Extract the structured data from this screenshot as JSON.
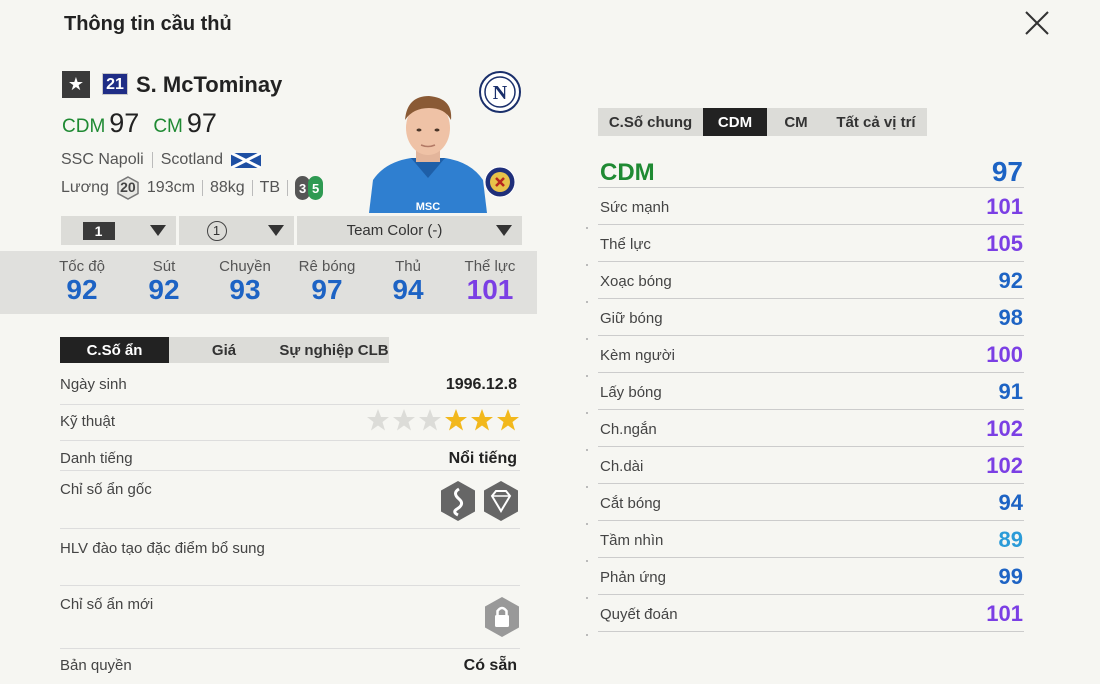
{
  "window": {
    "title": "Thông tin cầu thủ"
  },
  "player": {
    "season_num": "21",
    "name": "S. McTominay",
    "pos1_label": "CDM",
    "pos1_value": "97",
    "pos2_label": "CM",
    "pos2_value": "97",
    "club": "SSC Napoli",
    "nation": "Scotland",
    "salary_label": "Lương",
    "salary": "20",
    "height": "193cm",
    "weight": "88kg",
    "body_type": "TB",
    "weak_foot_left": "3",
    "weak_foot_right": "5"
  },
  "selectors": {
    "level": "1",
    "enhance": "1",
    "team_color": "Team Color (-)"
  },
  "main_stats": [
    {
      "label": "Tốc độ",
      "value": "92",
      "color": "#1d63c4"
    },
    {
      "label": "Sút",
      "value": "92",
      "color": "#1d63c4"
    },
    {
      "label": "Chuyền",
      "value": "93",
      "color": "#1d63c4"
    },
    {
      "label": "Rê bóng",
      "value": "97",
      "color": "#1d63c4"
    },
    {
      "label": "Thủ",
      "value": "94",
      "color": "#1d63c4"
    },
    {
      "label": "Thể lực",
      "value": "101",
      "color": "#7b3fe4"
    }
  ],
  "info_tabs": [
    "C.Số ẩn",
    "Giá",
    "Sự nghiệp CLB"
  ],
  "info": {
    "birth_label": "Ngày sinh",
    "birth": "1996.12.8",
    "skill_label": "Kỹ thuật",
    "skill_stars": 3,
    "skill_max": 6,
    "rep_label": "Danh tiếng",
    "rep": "Nổi tiếng",
    "traits_label": "Chỉ số ẩn gốc",
    "coach_label": "HLV đào tạo đặc điểm bổ sung",
    "new_traits_label": "Chỉ số ẩn mới",
    "license_label": "Bản quyền",
    "license": "Có sẵn"
  },
  "pos_tabs": [
    "C.Số chung",
    "CDM",
    "CM",
    "Tất cả vị trí"
  ],
  "pos_detail": {
    "label": "CDM",
    "value": "97",
    "rows": [
      {
        "label": "Sức mạnh",
        "value": "101",
        "color": "#7b3fe4"
      },
      {
        "label": "Thể lực",
        "value": "105",
        "color": "#7b3fe4"
      },
      {
        "label": "Xoạc bóng",
        "value": "92",
        "color": "#1d63c4"
      },
      {
        "label": "Giữ bóng",
        "value": "98",
        "color": "#1d63c4"
      },
      {
        "label": "Kèm người",
        "value": "100",
        "color": "#7b3fe4"
      },
      {
        "label": "Lấy bóng",
        "value": "91",
        "color": "#1d63c4"
      },
      {
        "label": "Ch.ngắn",
        "value": "102",
        "color": "#7b3fe4"
      },
      {
        "label": "Ch.dài",
        "value": "102",
        "color": "#7b3fe4"
      },
      {
        "label": "Cắt bóng",
        "value": "94",
        "color": "#1d63c4"
      },
      {
        "label": "Tầm nhìn",
        "value": "89",
        "color": "#2b9bd8"
      },
      {
        "label": "Phản ứng",
        "value": "99",
        "color": "#1d63c4"
      },
      {
        "label": "Quyết đoán",
        "value": "101",
        "color": "#7b3fe4"
      }
    ]
  },
  "colors": {
    "accent_green": "#1f8a33",
    "stat_blue": "#1d63c4",
    "stat_purple": "#7b3fe4",
    "dark": "#222222"
  },
  "icons": [
    "close-icon",
    "star-icon",
    "napoli-badge-icon",
    "scotland-flag-icon",
    "scotland-badge-icon",
    "chevron-down-icon",
    "trait-icon",
    "lock-icon"
  ]
}
